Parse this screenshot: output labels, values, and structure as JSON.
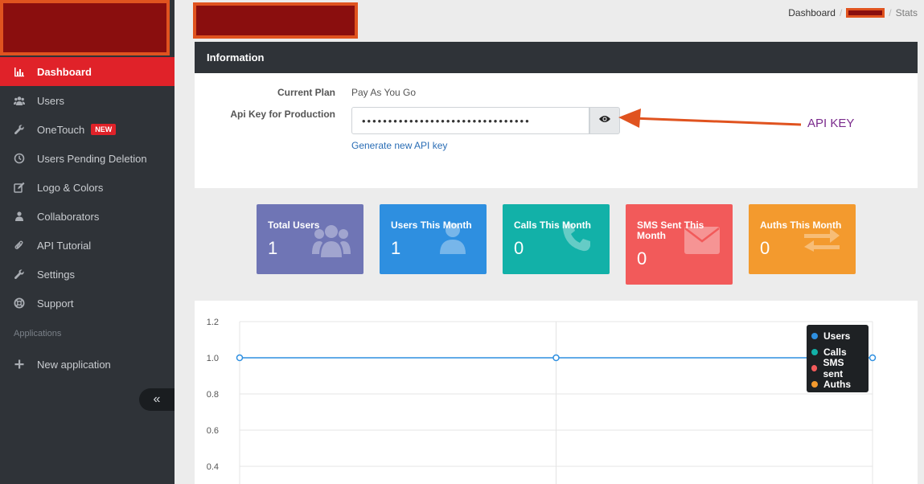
{
  "sidebar": {
    "items": [
      {
        "label": "Dashboard",
        "icon": "bar-chart-icon",
        "active": true
      },
      {
        "label": "Users",
        "icon": "users-icon"
      },
      {
        "label": "OneTouch",
        "icon": "wrench-icon",
        "badge": "NEW"
      },
      {
        "label": "Users Pending Deletion",
        "icon": "clock-icon"
      },
      {
        "label": "Logo & Colors",
        "icon": "edit-icon"
      },
      {
        "label": "Collaborators",
        "icon": "user-group-icon"
      },
      {
        "label": "API Tutorial",
        "icon": "paperclip-icon"
      },
      {
        "label": "Settings",
        "icon": "wrench-icon"
      },
      {
        "label": "Support",
        "icon": "lifebuoy-icon"
      }
    ],
    "section_label": "Applications",
    "new_app_label": "New application",
    "collapse_glyph": "«"
  },
  "breadcrumb": {
    "first": "Dashboard",
    "sep": "/",
    "last": "Stats"
  },
  "info": {
    "title": "Information",
    "plan_label": "Current Plan",
    "plan_value": "Pay As You Go",
    "key_label": "Api Key for Production",
    "key_value": "••••••••••••••••••••••••••••••••",
    "generate_label": "Generate new API key"
  },
  "annotation": {
    "text": "API KEY",
    "color": "#e0531f"
  },
  "stats": [
    {
      "label": "Total Users",
      "value": "1",
      "color": "#6f75b5",
      "icon": "users-icon"
    },
    {
      "label": "Users This Month",
      "value": "1",
      "color": "#2e8fe0",
      "icon": "user-icon"
    },
    {
      "label": "Calls This Month",
      "value": "0",
      "color": "#12b1a8",
      "icon": "phone-icon"
    },
    {
      "label": "SMS Sent This Month",
      "value": "0",
      "color": "#f25a5a",
      "icon": "envelope-icon"
    },
    {
      "label": "Auths This Month",
      "value": "0",
      "color": "#f39a2e",
      "icon": "exchange-icon"
    }
  ],
  "chart_data": {
    "type": "line",
    "y_ticks": [
      "1.2",
      "1.0",
      "0.8",
      "0.6",
      "0.4"
    ],
    "ylim": [
      0.4,
      1.2
    ],
    "series": [
      {
        "name": "Users",
        "values": [
          1,
          1,
          1
        ],
        "color": "#2e8fe0"
      },
      {
        "name": "Calls",
        "color": "#12b1a8"
      },
      {
        "name": "SMS sent",
        "color": "#f25a5a"
      },
      {
        "name": "Auths",
        "color": "#f39a2e"
      }
    ]
  }
}
